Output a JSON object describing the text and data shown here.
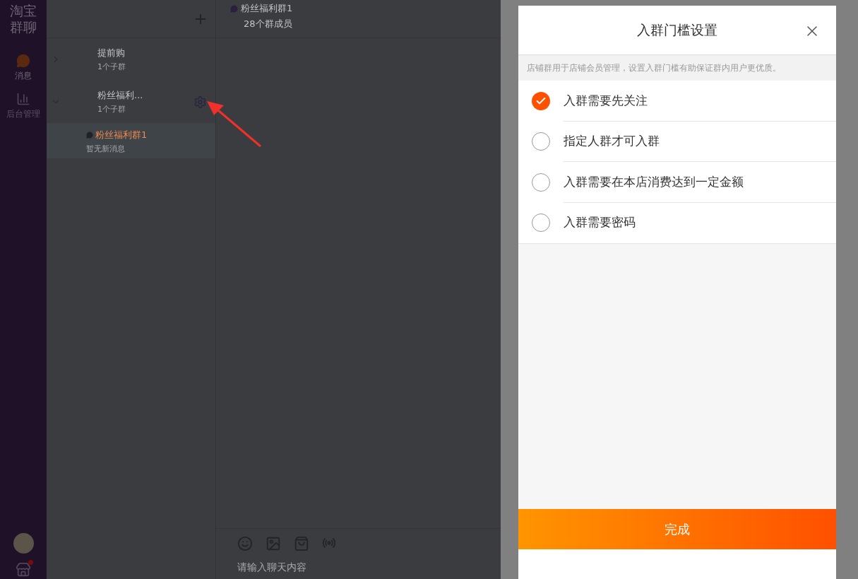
{
  "sidebar": {
    "logo": [
      "淘宝",
      "群聊"
    ],
    "nav": [
      {
        "label": "消息",
        "selected": true,
        "kind": "chat"
      },
      {
        "label": "后台管理",
        "selected": false,
        "kind": "stats"
      }
    ]
  },
  "groups": [
    {
      "name": "提前购",
      "subtitle": "1个子群",
      "expanded": false
    },
    {
      "name": "粉丝福利...",
      "subtitle": "1个子群",
      "expanded": true,
      "children": [
        {
          "name": "粉丝福利群1",
          "preview": "暂无新消息",
          "selected": true
        }
      ]
    }
  ],
  "chat": {
    "title": "粉丝福利群1",
    "members": "28个群成员",
    "input": {
      "placeholder": "请输入聊天内容"
    }
  },
  "modal": {
    "title": "入群门槛设置",
    "notice": "店铺群用于店铺会员管理，设置入群门槛有助保证群内用户更优质。",
    "options": [
      {
        "label": "入群需要先关注",
        "selected": true
      },
      {
        "label": "指定人群才可入群",
        "selected": false
      },
      {
        "label": "入群需要在本店消费达到一定金额",
        "selected": false
      },
      {
        "label": "入群需要密码",
        "selected": false
      }
    ],
    "confirm": "完成"
  }
}
